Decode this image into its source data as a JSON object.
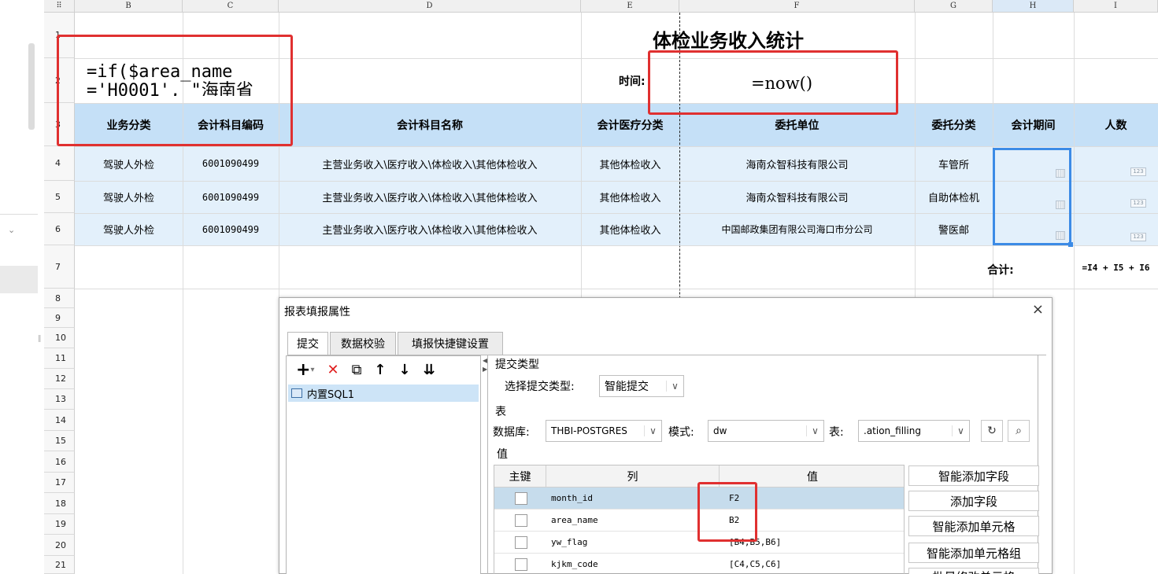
{
  "left_panel": {
    "collapse_glyph": "⌄",
    "resize_glyph": "‖"
  },
  "sheet": {
    "corner_glyph": "⠿",
    "columns": [
      "B",
      "C",
      "D",
      "E",
      "F",
      "G",
      "H",
      "I"
    ],
    "rows": [
      "1",
      "2",
      "3",
      "4",
      "5",
      "6",
      "7",
      "8",
      "9",
      "10",
      "11",
      "12",
      "13",
      "14",
      "15",
      "16",
      "17",
      "18",
      "19",
      "20",
      "21"
    ],
    "title": "体检业务收入统计",
    "b2_formula": "=if($area_name\n='H0001', \"海南省",
    "time_label": "时间:",
    "f2_formula": "=now()",
    "headers": [
      "业务分类",
      "会计科目编码",
      "会计科目名称",
      "会计医疗分类",
      "委托单位",
      "委托分类",
      "会计期间",
      "人数"
    ],
    "data_rows": [
      [
        "驾驶人外检",
        "6001090499",
        "主营业务收入\\医疗收入\\体检收入\\其他体检收入",
        "其他体检收入",
        "海南众智科技有限公司",
        "车管所"
      ],
      [
        "驾驶人外检",
        "6001090499",
        "主营业务收入\\医疗收入\\体检收入\\其他体检收入",
        "其他体检收入",
        "海南众智科技有限公司",
        "自助体检机"
      ],
      [
        "驾驶人外检",
        "6001090499",
        "主营业务收入\\医疗收入\\体检收入\\其他体检收入",
        "其他体检收入",
        "中国邮政集团有限公司海口市分公司",
        "警医邮"
      ]
    ],
    "number_icon_text": "123",
    "total_label": "合计:",
    "sum_formula": "=I4 + I5 + I6"
  },
  "dialog": {
    "title": "报表填报属性",
    "close": "×",
    "tabs": [
      "提交",
      "数据校验",
      "填报快捷键设置"
    ],
    "toolbar": {
      "add": "+",
      "add_arrow": "▾",
      "delete": "✕",
      "copy": "⧉",
      "up": "↑",
      "down": "↓",
      "sort": "⇊"
    },
    "pane_arrows": "◀\n▶",
    "sql_item": "内置SQL1",
    "submit_type_section": "提交类型",
    "select_submit_type_label": "选择提交类型:",
    "submit_type_value": "智能提交",
    "table_section": "表",
    "database_label": "数据库:",
    "database_value": "THBI-POSTGRES",
    "schema_label": "模式:",
    "schema_value": "dw",
    "table_label": "表:",
    "table_value": ".ation_filling",
    "refresh": "↻",
    "preview": "⌕",
    "value_section": "值",
    "dropdown_arrow": "∨",
    "value_table": {
      "headers": [
        "主键",
        "列",
        "值"
      ],
      "rows": [
        {
          "column": "month_id",
          "value": "F2"
        },
        {
          "column": "area_name",
          "value": "B2"
        },
        {
          "column": "yw_flag",
          "value": "[B4,B5,B6]"
        },
        {
          "column": "kjkm_code",
          "value": "[C4,C5,C6]"
        }
      ]
    },
    "side_buttons": [
      "智能添加字段",
      "添加字段",
      "智能添加单元格",
      "智能添加单元格组",
      "批量修改单元格"
    ]
  },
  "accent_colors": {
    "header_fill": "#c5e0f7",
    "data_fill": "#e3f0fb",
    "highlight": "#e03030",
    "selection": "#3c8be6"
  }
}
